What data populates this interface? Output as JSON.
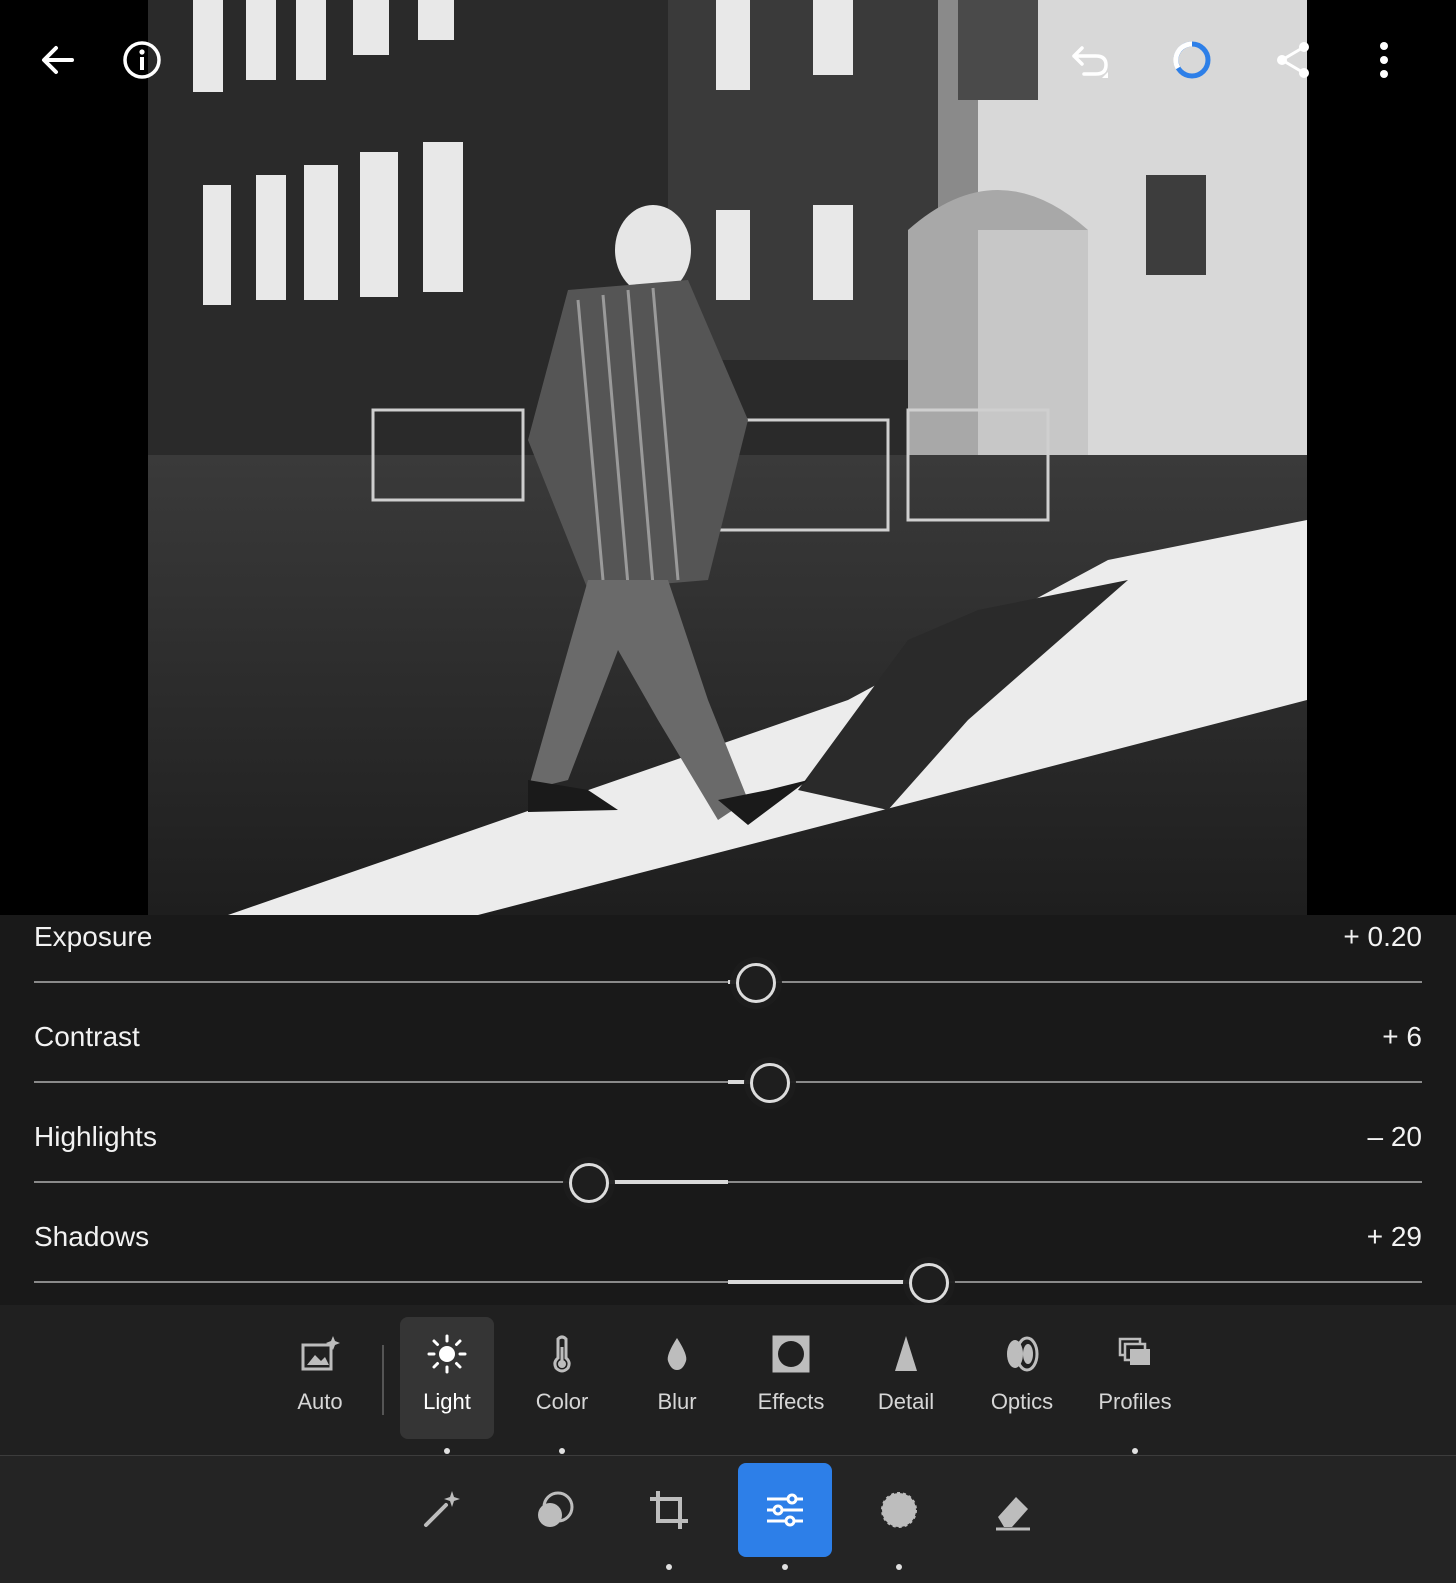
{
  "toolbar": {
    "back_icon": "arrow-left-icon",
    "info_icon": "info-icon",
    "undo_icon": "undo-icon",
    "sync_icon": "sync-progress-ring-icon",
    "share_icon": "share-icon",
    "more_icon": "more-vertical-icon",
    "sync_color": "#2d7fe8"
  },
  "photo": {
    "mode": "black-and-white",
    "icon": "street-photo-image"
  },
  "adjustments": [
    {
      "label": "Exposure",
      "value": "+ 0.20",
      "position": 0.52
    },
    {
      "label": "Contrast",
      "value": "+ 6",
      "position": 0.53
    },
    {
      "label": "Highlights",
      "value": "– 20",
      "position": 0.4
    },
    {
      "label": "Shadows",
      "value": "+ 29",
      "position": 0.645
    }
  ],
  "tools": [
    {
      "label": "Auto",
      "icon": "auto-image-icon"
    },
    {
      "label": "Light",
      "icon": "sun-icon",
      "active": true
    },
    {
      "label": "Color",
      "icon": "thermometer-icon"
    },
    {
      "label": "Blur",
      "icon": "drop-icon"
    },
    {
      "label": "Effects",
      "icon": "vignette-icon"
    },
    {
      "label": "Detail",
      "icon": "triangle-icon"
    },
    {
      "label": "Optics",
      "icon": "lens-icon"
    },
    {
      "label": "Profiles",
      "icon": "profiles-icon"
    }
  ],
  "bottom_nav": [
    {
      "name": "auto-magic",
      "icon": "magic-wand-icon"
    },
    {
      "name": "presets",
      "icon": "presets-icon"
    },
    {
      "name": "crop",
      "icon": "crop-icon"
    },
    {
      "name": "edit",
      "icon": "sliders-icon",
      "active": true
    },
    {
      "name": "masking",
      "icon": "masking-icon"
    },
    {
      "name": "healing",
      "icon": "eraser-icon"
    }
  ],
  "colors": {
    "accent": "#2d7fe8",
    "panel_bg": "#1c1c1c"
  }
}
